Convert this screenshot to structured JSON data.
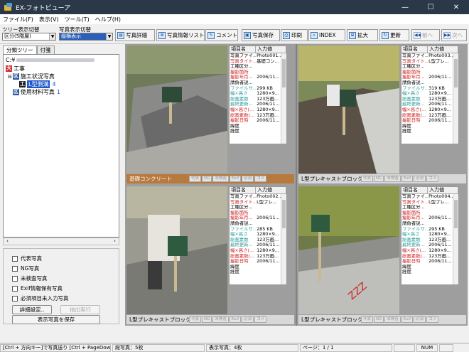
{
  "window": {
    "title": "EX-フォトビューア",
    "controls": {
      "minimize": "—",
      "maximize": "☐",
      "close": "✕"
    }
  },
  "menu": [
    "ファイル(F)",
    "表示(V)",
    "ツール(T)",
    "ヘルプ(H)"
  ],
  "toolbar": {
    "tree_switch_label": "ツリー表示切替",
    "tree_switch_value": "区分(5階層)",
    "photo_switch_label": "写真表示切替",
    "photo_switch_value": "縦横表示",
    "buttons": [
      {
        "label": "写真詳細",
        "icon": "photo-detail-icon",
        "glyph": "▤",
        "enabled": true
      },
      {
        "label": "写真情報リスト",
        "icon": "info-list-icon",
        "glyph": "≣",
        "enabled": true
      },
      {
        "label": "コメント",
        "icon": "comment-icon",
        "glyph": "✎",
        "enabled": true
      },
      {
        "label": "写真保存",
        "icon": "save-photo-icon",
        "glyph": "▣",
        "enabled": true
      },
      {
        "label": "印刷",
        "icon": "print-icon",
        "glyph": "⎙",
        "enabled": true
      },
      {
        "label": "INDEX",
        "icon": "index-icon",
        "glyph": "⌕",
        "enabled": true
      },
      {
        "label": "拡大",
        "icon": "zoom-icon",
        "glyph": "⊞",
        "enabled": true
      },
      {
        "label": "更新",
        "icon": "refresh-icon",
        "glyph": "↻",
        "enabled": true
      },
      {
        "label": "前へ",
        "icon": "prev-icon",
        "glyph": "◀◀",
        "enabled": false
      },
      {
        "label": "次へ",
        "icon": "next-icon",
        "glyph": "▶▶",
        "enabled": false
      }
    ]
  },
  "left": {
    "tabs": [
      "分類ツリー",
      "付箋"
    ],
    "tree": {
      "root": "C:¥",
      "nodes": [
        {
          "badge": "大",
          "label": "工事",
          "badge_color": "#d03030"
        },
        {
          "badge": "区",
          "label": "施工状況写真",
          "badge_color": "#2a5aa0"
        },
        {
          "badge": "工",
          "label": "L型側溝",
          "count": "4",
          "badge_color": "#1a1a1a"
        },
        {
          "badge": "区",
          "label": "使用材料写真",
          "count": "1",
          "badge_color": "#2a5aa0"
        }
      ]
    },
    "filters": [
      "代表写真",
      "NG写真",
      "未検査写真",
      "Exif情報保有写真",
      "必須項目未入力写真"
    ],
    "detail_button": "詳細設定..",
    "extract_button": "抽出実行",
    "save_button": "表示写真を保存"
  },
  "props_header": {
    "name": "項目名",
    "value": "入力値"
  },
  "tags": [
    "代表",
    "NG",
    "未検査",
    "Exif",
    "必須",
    "コメ"
  ],
  "photos": [
    {
      "caption": "基礎コンクリート",
      "caption_style": "brown",
      "props": [
        {
          "k": "写真ファイ...",
          "v": "Photo001...",
          "c": "#000"
        },
        {
          "k": "写真タイト...",
          "v": "基礎コン...",
          "c": "#d02020"
        },
        {
          "k": "工種区分...",
          "v": "",
          "c": "#000"
        },
        {
          "k": "撮影箇所",
          "v": "",
          "c": "#d02020"
        },
        {
          "k": "撮影年月...",
          "v": "2006/11...",
          "c": "#d02020"
        },
        {
          "k": "請負者説...",
          "v": "",
          "c": "#000"
        },
        {
          "k": "ファイルサ...",
          "v": "299 KB",
          "c": "#2a9a9a"
        },
        {
          "k": "幅×高さ",
          "v": "1280×9...",
          "c": "#2a9a9a"
        },
        {
          "k": "総画素数",
          "v": "123万画...",
          "c": "#2a9a9a"
        },
        {
          "k": "最終更新...",
          "v": "2006/11...",
          "c": "#2a9a9a"
        },
        {
          "k": "幅×高さ(...",
          "v": "1280×9...",
          "c": "#d02020"
        },
        {
          "k": "総画素数(...",
          "v": "123万画...",
          "c": "#d02020"
        },
        {
          "k": "撮影日時",
          "v": "2006/11...",
          "c": "#d02020"
        },
        {
          "k": "緯度",
          "v": "",
          "c": "#000"
        },
        {
          "k": "経度",
          "v": "",
          "c": "#000"
        }
      ]
    },
    {
      "caption": "L型プレキャストブロック",
      "caption_style": "light",
      "props": [
        {
          "k": "写真ファイ...",
          "v": "Photo003...",
          "c": "#000"
        },
        {
          "k": "写真タイト...",
          "v": "L型プレ...",
          "c": "#d02020"
        },
        {
          "k": "工種区分...",
          "v": "",
          "c": "#000"
        },
        {
          "k": "撮影箇所",
          "v": "",
          "c": "#d02020"
        },
        {
          "k": "撮影年月...",
          "v": "2006/11...",
          "c": "#d02020"
        },
        {
          "k": "請負者説...",
          "v": "",
          "c": "#000"
        },
        {
          "k": "ファイルサ...",
          "v": "319 KB",
          "c": "#2a9a9a"
        },
        {
          "k": "幅×高さ",
          "v": "1280×9...",
          "c": "#2a9a9a"
        },
        {
          "k": "総画素数",
          "v": "123万画...",
          "c": "#2a9a9a"
        },
        {
          "k": "最終更新...",
          "v": "2006/11...",
          "c": "#2a9a9a"
        },
        {
          "k": "幅×高さ(...",
          "v": "1280×9...",
          "c": "#d02020"
        },
        {
          "k": "総画素数(...",
          "v": "123万画...",
          "c": "#d02020"
        },
        {
          "k": "撮影日時",
          "v": "2006/11...",
          "c": "#d02020"
        },
        {
          "k": "緯度",
          "v": "",
          "c": "#000"
        },
        {
          "k": "経度",
          "v": "",
          "c": "#000"
        }
      ]
    },
    {
      "caption": "L型プレキャストブロック",
      "caption_style": "light",
      "props": [
        {
          "k": "写真ファイ...",
          "v": "Photo002...",
          "c": "#000"
        },
        {
          "k": "写真タイト...",
          "v": "L型プレ...",
          "c": "#d02020"
        },
        {
          "k": "工種区分...",
          "v": "",
          "c": "#000"
        },
        {
          "k": "撮影箇所",
          "v": "",
          "c": "#d02020"
        },
        {
          "k": "撮影年月...",
          "v": "2006/11...",
          "c": "#d02020"
        },
        {
          "k": "請負者説...",
          "v": "",
          "c": "#000"
        },
        {
          "k": "ファイルサ...",
          "v": "285 KB",
          "c": "#2a9a9a"
        },
        {
          "k": "幅×高さ",
          "v": "1280×9...",
          "c": "#2a9a9a"
        },
        {
          "k": "総画素数",
          "v": "123万画...",
          "c": "#2a9a9a"
        },
        {
          "k": "最終更新...",
          "v": "2006/11...",
          "c": "#2a9a9a"
        },
        {
          "k": "幅×高さ(...",
          "v": "1280×9...",
          "c": "#d02020"
        },
        {
          "k": "総画素数(...",
          "v": "123万画...",
          "c": "#d02020"
        },
        {
          "k": "撮影日時",
          "v": "2006/11...",
          "c": "#d02020"
        },
        {
          "k": "緯度",
          "v": "",
          "c": "#000"
        },
        {
          "k": "経度",
          "v": "",
          "c": "#000"
        }
      ]
    },
    {
      "caption": "L型プレキャストブロック",
      "caption_style": "light",
      "props": [
        {
          "k": "写真ファイ...",
          "v": "Photo004...",
          "c": "#000"
        },
        {
          "k": "写真タイト...",
          "v": "L型プレ...",
          "c": "#d02020"
        },
        {
          "k": "工種区分...",
          "v": "",
          "c": "#000"
        },
        {
          "k": "撮影箇所",
          "v": "",
          "c": "#d02020"
        },
        {
          "k": "撮影年月...",
          "v": "2006/11...",
          "c": "#d02020"
        },
        {
          "k": "請負者説...",
          "v": "",
          "c": "#000"
        },
        {
          "k": "ファイルサ...",
          "v": "295 KB",
          "c": "#2a9a9a"
        },
        {
          "k": "幅×高さ",
          "v": "1280×9...",
          "c": "#2a9a9a"
        },
        {
          "k": "総画素数",
          "v": "123万画...",
          "c": "#2a9a9a"
        },
        {
          "k": "最終更新...",
          "v": "2006/11...",
          "c": "#2a9a9a"
        },
        {
          "k": "幅×高さ(...",
          "v": "1280×9...",
          "c": "#d02020"
        },
        {
          "k": "総画素数(...",
          "v": "123万画...",
          "c": "#d02020"
        },
        {
          "k": "撮影日時",
          "v": "2006/11...",
          "c": "#d02020"
        },
        {
          "k": "緯度",
          "v": "",
          "c": "#000"
        },
        {
          "k": "経度",
          "v": "",
          "c": "#000"
        }
      ]
    }
  ],
  "status": [
    "[Ctrl + 方向キー]で写真送り [Ctrl + PageDow",
    "総写真：5枚",
    "表示写真：4枚",
    "ページ：1 / 1",
    "",
    "NUM",
    ""
  ]
}
